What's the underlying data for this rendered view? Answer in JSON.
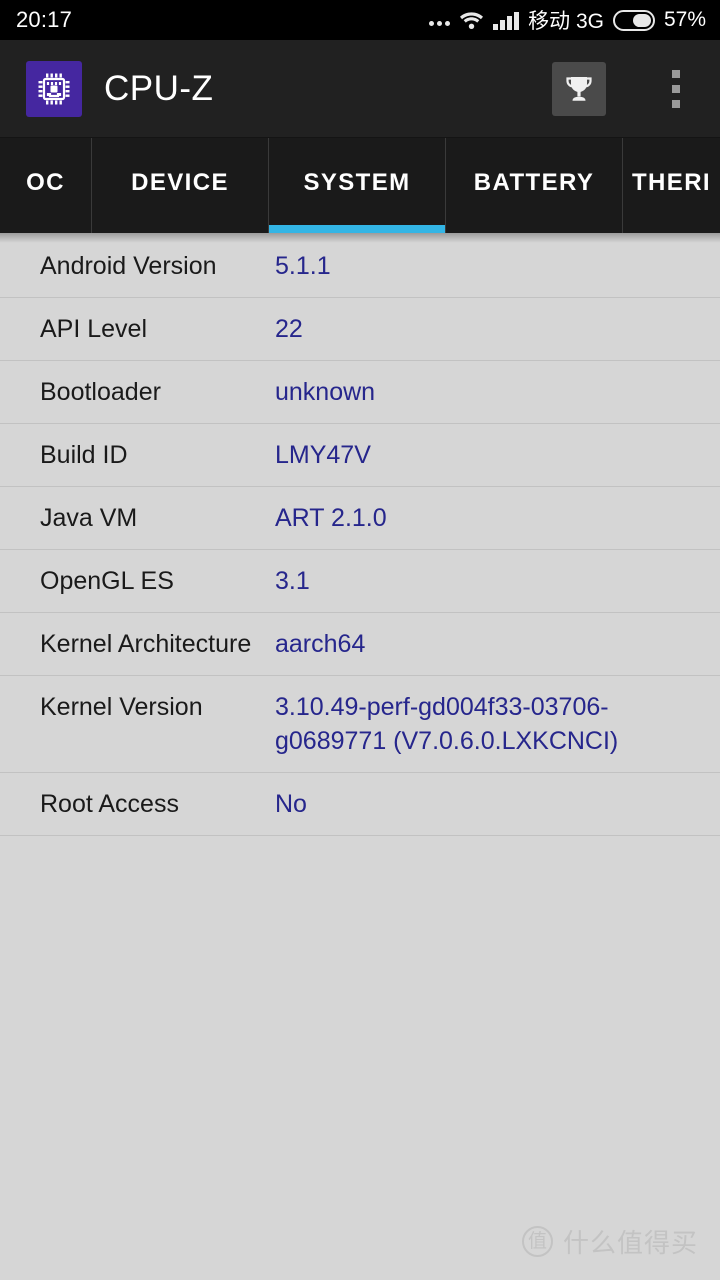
{
  "statusbar": {
    "time": "20:17",
    "dots_icon": "more-dots-icon",
    "wifi_icon": "wifi-icon",
    "signal_icon": "signal-bars-icon",
    "carrier": "移动 3G",
    "battery_icon": "battery-icon",
    "battery_percent": "57%"
  },
  "appbar": {
    "app_icon": "cpu-chip-icon",
    "title": "CPU-Z",
    "trophy_icon": "trophy-icon",
    "overflow_icon": "overflow-menu-icon"
  },
  "tabs": [
    {
      "label": "OC",
      "active": false,
      "width": 92
    },
    {
      "label": "DEVICE",
      "active": false,
      "width": 177
    },
    {
      "label": "SYSTEM",
      "active": true,
      "width": 177
    },
    {
      "label": "BATTERY",
      "active": false,
      "width": 177
    },
    {
      "label": "THERI",
      "active": false,
      "width": 97
    }
  ],
  "system": {
    "rows": [
      {
        "label": "Android Version",
        "value": "5.1.1"
      },
      {
        "label": "API Level",
        "value": "22"
      },
      {
        "label": "Bootloader",
        "value": "unknown"
      },
      {
        "label": "Build ID",
        "value": "LMY47V"
      },
      {
        "label": "Java VM",
        "value": "ART 2.1.0"
      },
      {
        "label": "OpenGL ES",
        "value": "3.1"
      },
      {
        "label": "Kernel Architecture",
        "value": "aarch64"
      },
      {
        "label": "Kernel Version",
        "value": "3.10.49-perf-gd004f33-03706-g0689771 (V7.0.6.0.LXKCNCI)"
      },
      {
        "label": "Root Access",
        "value": "No"
      }
    ]
  },
  "watermark": {
    "logo_glyph": "值",
    "text": "什么值得买"
  },
  "colors": {
    "accent": "#33b5e5",
    "value_text": "#26268c",
    "app_icon_bg": "#4527a0",
    "content_bg": "#d6d6d6",
    "appbar_bg": "#212121"
  }
}
